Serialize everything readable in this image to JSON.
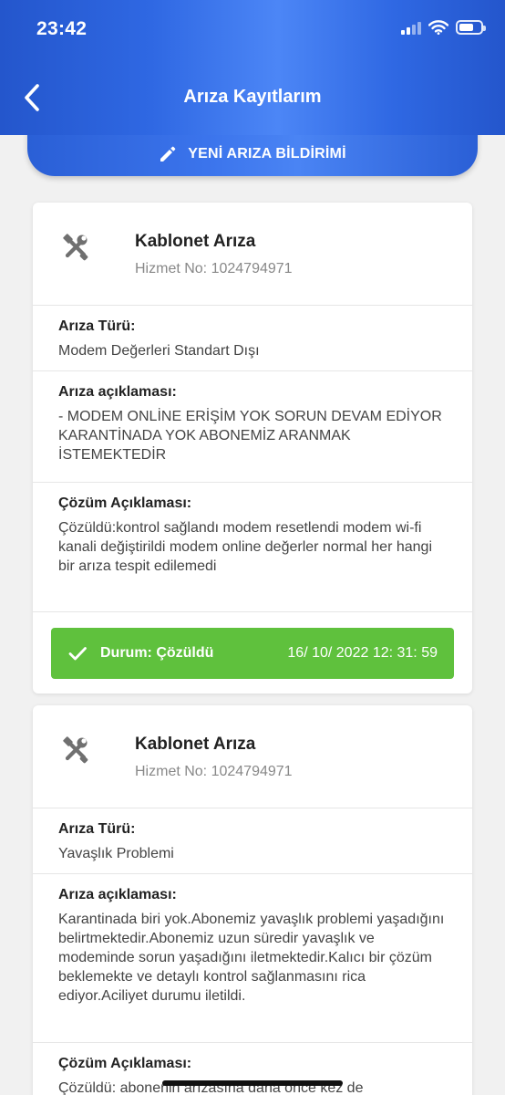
{
  "status_bar": {
    "time": "23:42"
  },
  "header": {
    "title": "Arıza Kayıtlarım"
  },
  "new_fault_button": {
    "label": "YENİ ARIZA BİLDİRİMİ"
  },
  "records": [
    {
      "title": "Kablonet Arıza",
      "service_no": "Hizmet No: 1024794971",
      "type_label": "Arıza Türü:",
      "type": "Modem Değerleri Standart Dışı",
      "desc_label": "Arıza açıklaması:",
      "description": "- MODEM ONLİNE ERİŞİM YOK  SORUN DEVAM EDİYOR  KARANTİNADA YOK  ABONEMİZ ARANMAK İSTEMEKTEDİR",
      "solution_label": "Çözüm Açıklaması:",
      "solution": "Çözüldü:kontrol sağlandı modem resetlendi modem wi-fi kanali değiştirildi modem online değerler normal her hangi bir arıza tespit edilemedi",
      "status": "Durum: Çözüldü",
      "date": "16/ 10/ 2022 12: 31: 59"
    },
    {
      "title": "Kablonet Arıza",
      "service_no": "Hizmet No: 1024794971",
      "type_label": "Arıza Türü:",
      "type": "Yavaşlık Problemi",
      "desc_label": "Arıza açıklaması:",
      "description": "Karantinada biri yok.Abonemiz yavaşlık problemi yaşadığını belirtmektedir.Abonemiz uzun süredir yavaşlık ve modeminde sorun yaşadığını iletmektedir.Kalıcı bir çözüm beklemekte ve detaylı kontrol sağlanmasını rica ediyor.Aciliyet durumu iletildi.",
      "solution_label": "Çözüm Açıklaması:",
      "solution": "Çözüldü: abonenin arızasına daha önce kez de"
    }
  ],
  "colors": {
    "header": "#2f68e3",
    "status_success": "#5fc13d",
    "background": "#f1f1f1"
  },
  "icons": {
    "back": "chevron-left-icon",
    "edit": "pencil-icon",
    "record": "tools-icon",
    "status": "check-icon"
  }
}
